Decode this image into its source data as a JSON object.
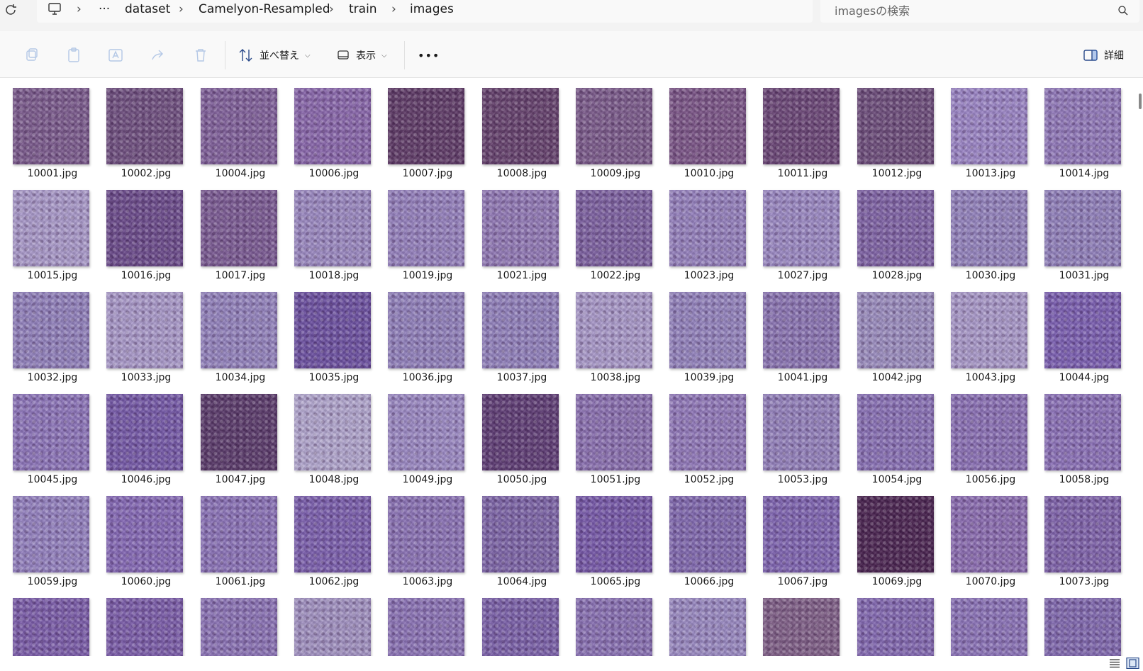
{
  "breadcrumb": {
    "overflow": "···",
    "items": [
      "dataset",
      "Camelyon-Resampled",
      "train",
      "images"
    ]
  },
  "search": {
    "placeholder": "imagesの検索"
  },
  "toolbar": {
    "sort_label": "並べ替え",
    "view_label": "表示",
    "more_label": "•••",
    "details_label": "詳細"
  },
  "files": [
    "10001.jpg",
    "10002.jpg",
    "10004.jpg",
    "10006.jpg",
    "10007.jpg",
    "10008.jpg",
    "10009.jpg",
    "10010.jpg",
    "10011.jpg",
    "10012.jpg",
    "10013.jpg",
    "10014.jpg",
    "10015.jpg",
    "10016.jpg",
    "10017.jpg",
    "10018.jpg",
    "10019.jpg",
    "10021.jpg",
    "10022.jpg",
    "10023.jpg",
    "10027.jpg",
    "10028.jpg",
    "10030.jpg",
    "10031.jpg",
    "10032.jpg",
    "10033.jpg",
    "10034.jpg",
    "10035.jpg",
    "10036.jpg",
    "10037.jpg",
    "10038.jpg",
    "10039.jpg",
    "10041.jpg",
    "10042.jpg",
    "10043.jpg",
    "10044.jpg",
    "10045.jpg",
    "10046.jpg",
    "10047.jpg",
    "10048.jpg",
    "10049.jpg",
    "10050.jpg",
    "10051.jpg",
    "10052.jpg",
    "10053.jpg",
    "10054.jpg",
    "10056.jpg",
    "10058.jpg",
    "10059.jpg",
    "10060.jpg",
    "10061.jpg",
    "10062.jpg",
    "10063.jpg",
    "10064.jpg",
    "10065.jpg",
    "10066.jpg",
    "10067.jpg",
    "10069.jpg",
    "10070.jpg",
    "10073.jpg",
    "",
    "",
    "",
    "",
    "",
    "",
    "",
    "",
    "",
    "",
    "",
    ""
  ],
  "thumb_tones": [
    "#7a5a8c",
    "#6e4e7e",
    "#80609a",
    "#8866aa",
    "#5e3a66",
    "#64406c",
    "#7a5a8a",
    "#7a5486",
    "#6a4676",
    "#6c4c7a",
    "#9a84c4",
    "#9078b8",
    "#a898c8",
    "#6a4a8a",
    "#7a5a92",
    "#9a88c0",
    "#9480bc",
    "#9078b4",
    "#7c60a0",
    "#9480bc",
    "#9a88c2",
    "#7e62a4",
    "#9282bc",
    "#9080ba",
    "#9080ba",
    "#a898c8",
    "#9282bc",
    "#6c50a0",
    "#9080ba",
    "#9080ba",
    "#a898c8",
    "#9282bc",
    "#8a74b2",
    "#9a8cbe",
    "#a898c8",
    "#7a5eb0",
    "#8c74b8",
    "#7458a6",
    "#5a3a6a",
    "#b0a4cc",
    "#9a88c2",
    "#5e3c74",
    "#8a70b0",
    "#9078b8",
    "#9280ba",
    "#8870b4",
    "#8a70b4",
    "#8a70b6",
    "#9280be",
    "#8468b4",
    "#8a72b6",
    "#7a5eac",
    "#8a72b4",
    "#7c64a6",
    "#7658a8",
    "#8068ae",
    "#7e64b0",
    "#4a2450",
    "#8a6cb0",
    "#7e62aa",
    "#7a5ca8",
    "#7a5ca8",
    "#8a72b4",
    "#a090c0",
    "#8a72b4",
    "#7a60a8",
    "#8870b2",
    "#9888c0",
    "#7e5e86",
    "#8268b0",
    "#8a72b6",
    "#8068ae"
  ]
}
